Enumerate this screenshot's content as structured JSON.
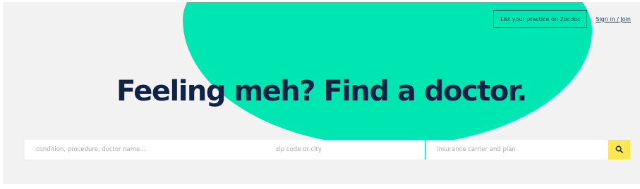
{
  "header": {
    "practice_label": "List your practice on Zocdoc",
    "signin_label": "Sign in / Join"
  },
  "hero": {
    "headline": "Feeling meh? Find a doctor."
  },
  "search": {
    "condition_placeholder": "condition, procedure, doctor name...",
    "zip_placeholder": "zip code or city",
    "insurance_placeholder": "insurance carrier and plan",
    "button_icon": "search-icon"
  },
  "colors": {
    "background": "#f2f2f2",
    "blob": "#00e6b3",
    "navy": "#0e2346",
    "search_button": "#ffe74d",
    "divider": "#00c9a0"
  }
}
